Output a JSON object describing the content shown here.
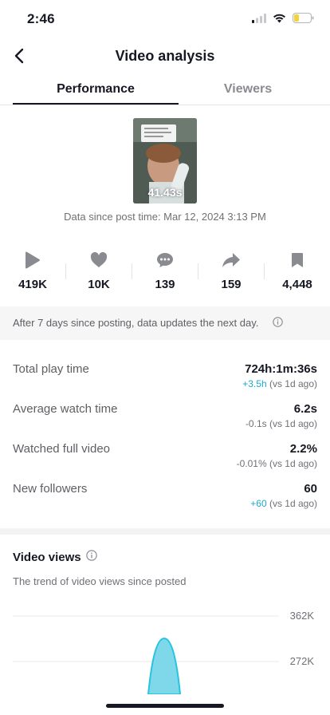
{
  "status_bar": {
    "time": "2:46"
  },
  "header": {
    "title": "Video analysis"
  },
  "tabs": [
    {
      "label": "Performance",
      "active": true
    },
    {
      "label": "Viewers",
      "active": false
    }
  ],
  "video": {
    "duration": "41.43s",
    "post_time": "Data since post time: Mar 12, 2024 3:13 PM"
  },
  "stats": [
    {
      "icon": "play-icon",
      "value": "419K"
    },
    {
      "icon": "heart-icon",
      "value": "10K"
    },
    {
      "icon": "comment-icon",
      "value": "139"
    },
    {
      "icon": "share-icon",
      "value": "159"
    },
    {
      "icon": "bookmark-icon",
      "value": "4,448"
    }
  ],
  "notice": {
    "text": "After 7 days since posting, data updates the next day."
  },
  "metrics": [
    {
      "label": "Total play time",
      "value": "724h:1m:36s",
      "delta": "+3.5h",
      "comparison": "(vs 1d ago)",
      "positive": true
    },
    {
      "label": "Average watch time",
      "value": "6.2s",
      "delta": "-0.1s",
      "comparison": "(vs 1d ago)",
      "positive": false
    },
    {
      "label": "Watched full video",
      "value": "2.2%",
      "delta": "-0.01%",
      "comparison": "(vs 1d ago)",
      "positive": false
    },
    {
      "label": "New followers",
      "value": "60",
      "delta": "+60",
      "comparison": "(vs 1d ago)",
      "positive": true
    }
  ],
  "video_views": {
    "title": "Video views",
    "subtitle": "The trend of video views since posted"
  },
  "chart_data": {
    "type": "area",
    "y_ticks": [
      "362K",
      "272K"
    ],
    "color": "#7fd8ea",
    "stroke": "#25c4e0",
    "grid": true
  },
  "colors": {
    "accent": "#20a8c8",
    "text": "#161823",
    "muted": "#6f7076"
  }
}
